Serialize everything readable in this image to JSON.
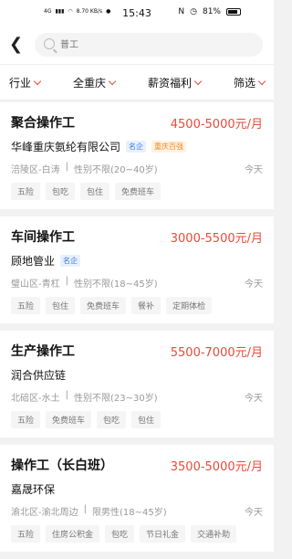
{
  "status": {
    "time": "15:43",
    "network": "4G",
    "speed": "8.70 KB/s",
    "battery": "81%"
  },
  "search": {
    "placeholder": "普工"
  },
  "filters": [
    "行业",
    "全重庆",
    "薪资福利",
    "筛选"
  ],
  "jobs": [
    {
      "title": "聚合操作工",
      "salary": "4500-5000元/月",
      "company": "华峰重庆氨纶有限公司",
      "badges": [
        {
          "text": "名企",
          "style": "blue"
        },
        {
          "text": "重庆百强",
          "style": "orange"
        }
      ],
      "location": "涪陵区-白涛",
      "gender": "性别不限(20~40岁)",
      "time": "今天",
      "tags": [
        "五险",
        "包吃",
        "包住",
        "免费班车"
      ]
    },
    {
      "title": "车间操作工",
      "salary": "3000-5500元/月",
      "company": "顾地管业",
      "badges": [
        {
          "text": "名企",
          "style": "blue"
        }
      ],
      "location": "璧山区-青杠",
      "gender": "性别不限(18~45岁)",
      "time": "今天",
      "tags": [
        "五险",
        "包住",
        "免费班车",
        "餐补",
        "定期体检"
      ]
    },
    {
      "title": "生产操作工",
      "salary": "5500-7000元/月",
      "company": "润合供应链",
      "badges": [],
      "location": "北碚区-水土",
      "gender": "性别不限(23~30岁)",
      "time": "今天",
      "tags": [
        "五险",
        "免费班车",
        "包吃",
        "包住"
      ]
    },
    {
      "title": "操作工（长白班）",
      "salary": "3500-5000元/月",
      "company": "嘉晟环保",
      "badges": [],
      "location": "渝北区-渝北周边",
      "gender": "限男性(18~45岁)",
      "time": "今天",
      "tags": [
        "五险",
        "住房公积金",
        "包吃",
        "节日礼金",
        "交通补助"
      ]
    }
  ]
}
